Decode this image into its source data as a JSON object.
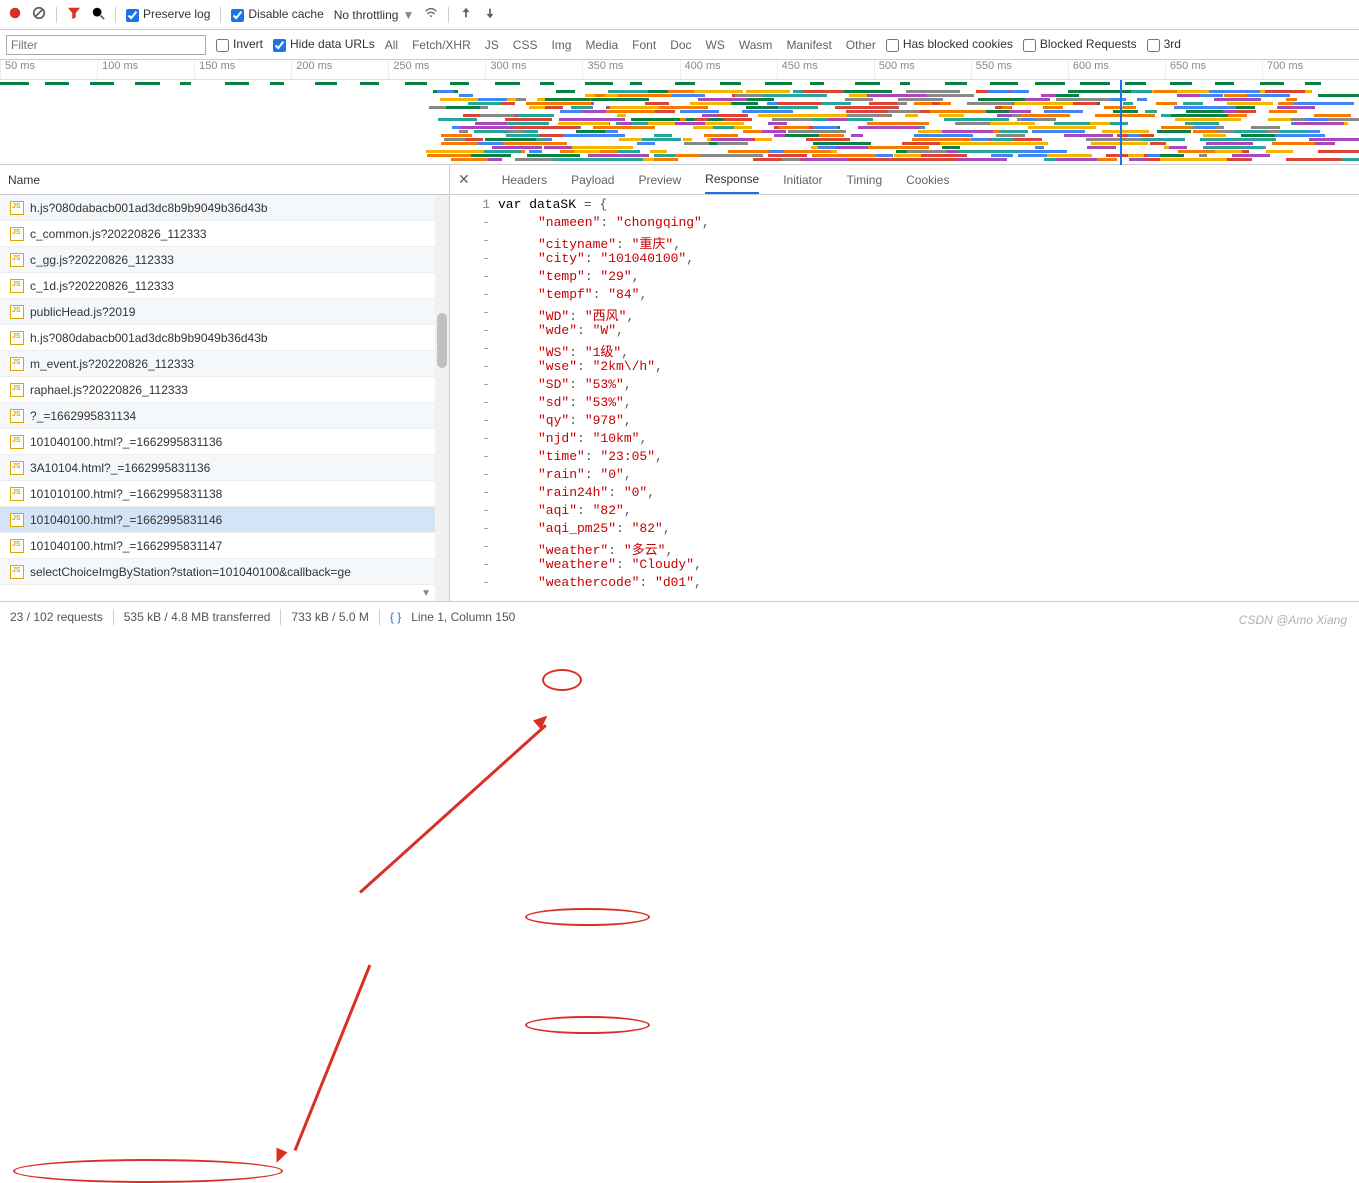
{
  "toolbar": {
    "preserve_log": "Preserve log",
    "disable_cache": "Disable cache",
    "throttling": "No throttling"
  },
  "filterbar": {
    "placeholder": "Filter",
    "invert": "Invert",
    "hide_urls": "Hide data URLs",
    "has_blocked": "Has blocked cookies",
    "blocked_req": "Blocked Requests",
    "third_party": "3rd",
    "types": [
      "All",
      "Fetch/XHR",
      "JS",
      "CSS",
      "Img",
      "Media",
      "Font",
      "Doc",
      "WS",
      "Wasm",
      "Manifest",
      "Other"
    ]
  },
  "timeline": {
    "ticks": [
      "50 ms",
      "100 ms",
      "150 ms",
      "200 ms",
      "250 ms",
      "300 ms",
      "350 ms",
      "400 ms",
      "450 ms",
      "500 ms",
      "550 ms",
      "600 ms",
      "650 ms",
      "700 ms"
    ]
  },
  "left": {
    "header": "Name",
    "rows": [
      "h.js?080dabacb001ad3dc8b9b9049b36d43b",
      "c_common.js?20220826_112333",
      "c_gg.js?20220826_112333",
      "c_1d.js?20220826_112333",
      "publicHead.js?2019",
      "h.js?080dabacb001ad3dc8b9b9049b36d43b",
      "m_event.js?20220826_112333",
      "raphael.js?20220826_112333",
      "?_=1662995831134",
      "101040100.html?_=1662995831136",
      "3A10104.html?_=1662995831136",
      "101010100.html?_=1662995831138",
      "101040100.html?_=1662995831146",
      "101040100.html?_=1662995831147",
      "selectChoiceImgByStation?station=101040100&callback=ge"
    ],
    "selected_index": 12
  },
  "tabs": {
    "items": [
      "Headers",
      "Payload",
      "Preview",
      "Response",
      "Initiator",
      "Timing",
      "Cookies"
    ],
    "active_index": 3
  },
  "response": {
    "var_decl": "var dataSK = {",
    "fields": [
      [
        "nameen",
        "chongqing"
      ],
      [
        "cityname",
        "重庆"
      ],
      [
        "city",
        "101040100"
      ],
      [
        "temp",
        "29"
      ],
      [
        "tempf",
        "84"
      ],
      [
        "WD",
        "西风"
      ],
      [
        "wde",
        "W"
      ],
      [
        "WS",
        "1级"
      ],
      [
        "wse",
        "2km\\/h"
      ],
      [
        "SD",
        "53%"
      ],
      [
        "sd",
        "53%"
      ],
      [
        "qy",
        "978"
      ],
      [
        "njd",
        "10km"
      ],
      [
        "time",
        "23:05"
      ],
      [
        "rain",
        "0"
      ],
      [
        "rain24h",
        "0"
      ],
      [
        "aqi",
        "82"
      ],
      [
        "aqi_pm25",
        "82"
      ],
      [
        "weather",
        "多云"
      ],
      [
        "weathere",
        "Cloudy"
      ],
      [
        "weathercode",
        "d01"
      ]
    ]
  },
  "status": {
    "requests": "23 / 102 requests",
    "transferred": "535 kB / 4.8 MB transferred",
    "resources": "733 kB / 5.0 M",
    "cursor": "Line 1, Column 150"
  },
  "watermark": "CSDN @Amo Xiang"
}
